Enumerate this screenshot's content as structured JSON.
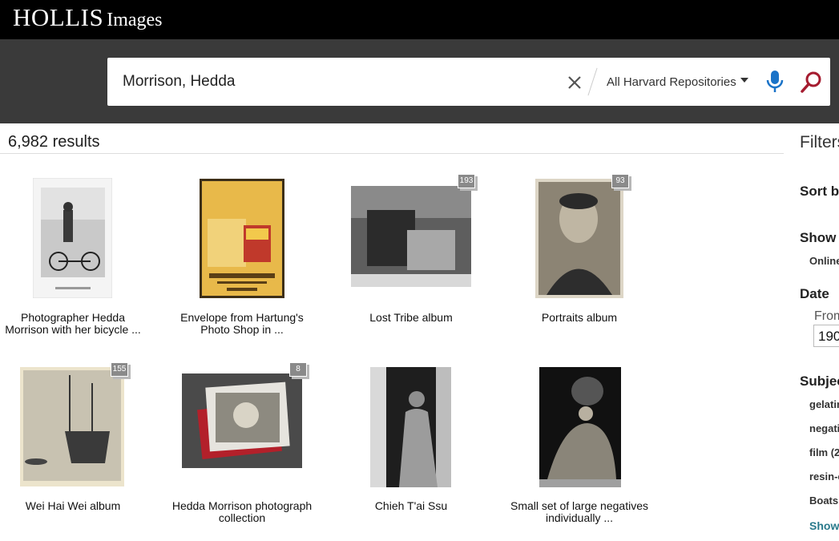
{
  "brand": {
    "name": "HOLLIS",
    "sub": "Images"
  },
  "search": {
    "query": "Morrison, Hedda",
    "scope": "All Harvard Repositories",
    "icons": {
      "clear": "close-icon",
      "mic": "microphone-icon",
      "search": "search-icon"
    }
  },
  "results": {
    "count_text": "6,982 results",
    "items": [
      {
        "title": "Photographer Hedda Morrison with her bicycle ..."
      },
      {
        "title": "Envelope from Hartung's Photo Shop in ..."
      },
      {
        "title": "Lost Tribe album",
        "badge": "193"
      },
      {
        "title": "Portraits album",
        "badge": "93"
      },
      {
        "title": "Wei Hai Wei album",
        "badge": "155"
      },
      {
        "title": "Hedda Morrison photograph collection",
        "badge": "8"
      },
      {
        "title": "Chieh T'ai Ssu"
      },
      {
        "title": "Small set of large negatives individually ..."
      }
    ]
  },
  "filters": {
    "title": "Filters",
    "sort": "Sort b",
    "show": "Show",
    "show_online": "Online",
    "date": "Date",
    "date_from_label": "From",
    "date_from_value": "190",
    "subject": "Subjec",
    "subjects": [
      "gelatin",
      "negati",
      "film (2",
      "resin-c",
      "Boats"
    ],
    "show_more": "Show"
  },
  "colors": {
    "topbar": "#000000",
    "search_band": "#3a3a3a",
    "mic": "#1a73c8",
    "search_icon": "#a51c30",
    "accent_link": "#2a7a8c"
  }
}
